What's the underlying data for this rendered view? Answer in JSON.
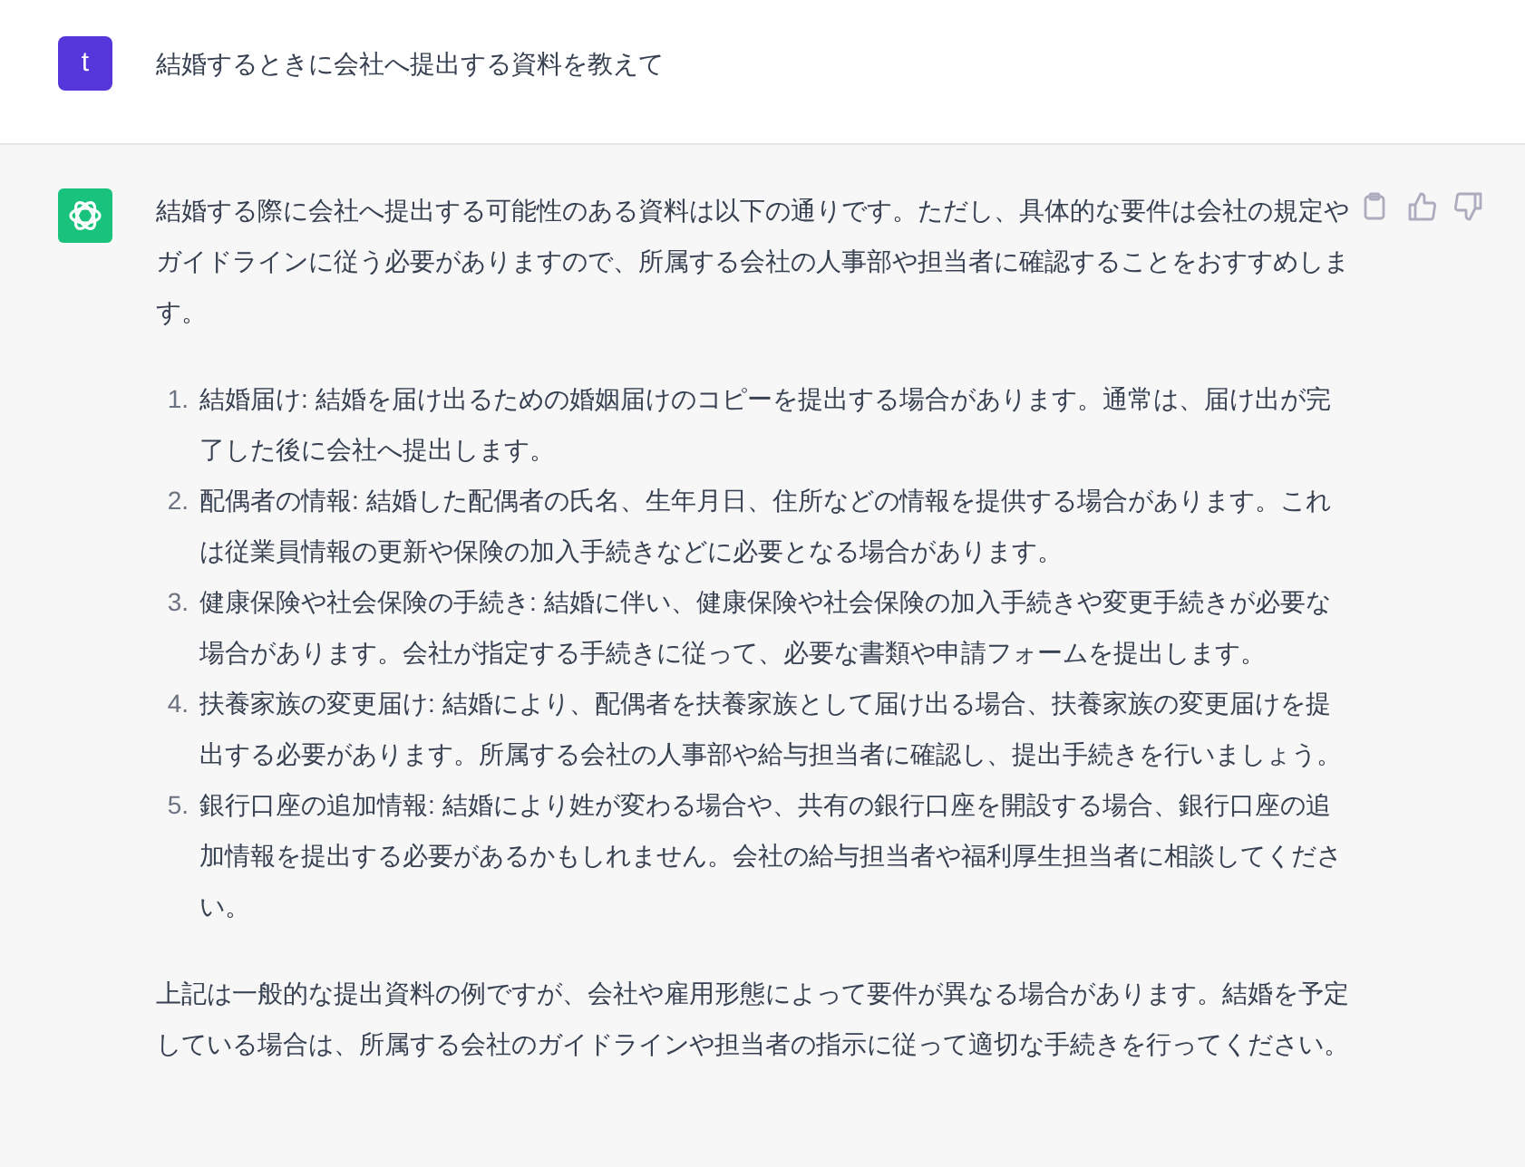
{
  "user_message": {
    "avatar_letter": "t",
    "text": "結婚するときに会社へ提出する資料を教えて"
  },
  "assistant_message": {
    "intro": "結婚する際に会社へ提出する可能性のある資料は以下の通りです。ただし、具体的な要件は会社の規定やガイドラインに従う必要がありますので、所属する会社の人事部や担当者に確認することをおすすめします。",
    "list": [
      {
        "number": "1.",
        "text": "結婚届け: 結婚を届け出るための婚姻届けのコピーを提出する場合があります。通常は、届け出が完了した後に会社へ提出します。"
      },
      {
        "number": "2.",
        "text": "配偶者の情報: 結婚した配偶者の氏名、生年月日、住所などの情報を提供する場合があります。これは従業員情報の更新や保険の加入手続きなどに必要となる場合があります。"
      },
      {
        "number": "3.",
        "text": "健康保険や社会保険の手続き: 結婚に伴い、健康保険や社会保険の加入手続きや変更手続きが必要な場合があります。会社が指定する手続きに従って、必要な書類や申請フォームを提出します。"
      },
      {
        "number": "4.",
        "text": "扶養家族の変更届け: 結婚により、配偶者を扶養家族として届け出る場合、扶養家族の変更届けを提出する必要があります。所属する会社の人事部や給与担当者に確認し、提出手続きを行いましょう。"
      },
      {
        "number": "5.",
        "text": "銀行口座の追加情報: 結婚により姓が変わる場合や、共有の銀行口座を開設する場合、銀行口座の追加情報を提出する必要があるかもしれません。会社の給与担当者や福利厚生担当者に相談してください。"
      }
    ],
    "outro": "上記は一般的な提出資料の例ですが、会社や雇用形態によって要件が異なる場合があります。結婚を予定している場合は、所属する会社のガイドラインや担当者の指示に従って適切な手続きを行ってください。"
  }
}
